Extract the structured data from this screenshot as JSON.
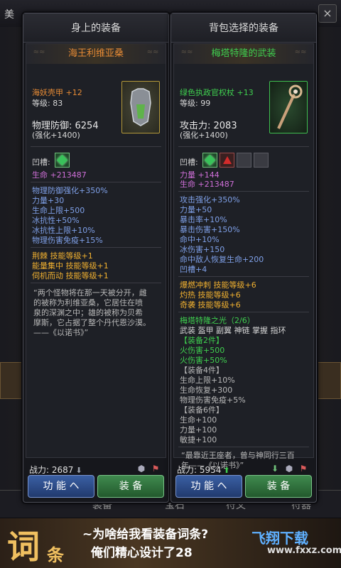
{
  "background": {
    "title_partial": "美",
    "close_glyph": "×",
    "tabs": [
      "装备",
      "宝石",
      "符文",
      "符器"
    ]
  },
  "left": {
    "panel_title": "身上的装备",
    "item_name": "海王利维亚桑",
    "item_type": "海妖壳甲 +12",
    "level": "等级: 83",
    "main_stat": "物理防御: 6254",
    "enhance": "(强化+1400)",
    "sockets_label": "凹槽:",
    "sockets": [
      "gem"
    ],
    "gem_bonus": "生命 +213487",
    "props": [
      "物理防御强化+350%",
      "力量+30",
      "生命上限+500",
      "冰抗性+50%",
      "冰抗性上限+10%",
      "物理伤害免疫+15%"
    ],
    "skills": [
      "荆棘 技能等级+1",
      "能量集中 技能等级+1",
      "伺机而动 技能等级+1"
    ],
    "lore": [
      "“两个怪物将在那一天被分开，雌",
      "的被称为利维亚桑，它居住在喷",
      "泉的深渊之中；雄的被称为贝希",
      "摩斯，它占据了整个丹代恩沙漠。",
      "——《以诺书》”"
    ],
    "power": "战力: 2687",
    "power_arrow": "⬇",
    "btn_func": "功 能 ヘ",
    "btn_equip": "装 备"
  },
  "right": {
    "panel_title": "背包选择的装备",
    "item_name": "梅塔特隆的武装",
    "item_type": "绿色执政官权杖 +13",
    "level": "等级: 99",
    "main_stat": "攻击力: 2083",
    "enhance": "(强化+1400)",
    "sockets_label": "凹槽:",
    "sockets": [
      "gem",
      "red",
      "empty",
      "empty"
    ],
    "gem_bonus": [
      "力量 +144",
      "生命 +213487"
    ],
    "props": [
      "攻击强化+350%",
      "力量+50",
      "暴击率+10%",
      "暴击伤害+150%",
      "命中+10%",
      "冰伤害+150",
      "命中敌人恢复生命+200",
      "凹槽+4"
    ],
    "skills": [
      "爆燃冲刺 技能等级+6",
      "灼热 技能等级+6",
      "奇袭 技能等级+6"
    ],
    "set_title": "梅塔特隆之光（2/6）",
    "set_pieces": "武装 盔甲 副翼 神链 掌握 指环",
    "set_bonus": [
      "【装备2件】",
      "火伤害+500",
      "火伤害+50%",
      "【装备4件】",
      "生命上限+10%",
      "生命恢复+300",
      "物理伤害免疫+5%",
      "【装备6件】",
      "生命+100",
      "力量+100",
      "敏捷+100"
    ],
    "lore": [
      "“最靠近王座者，曾与神同行三百",
      "年——《以诺书》”"
    ],
    "power": "战力: 5954",
    "power_arrow": "⬆",
    "btn_func": "功 能 ヘ",
    "btn_equip": "装 备"
  },
  "banner": {
    "big": "词",
    "small": "条",
    "line1": "~为啥给我看装备词条?",
    "line2": "俺们精心设计了28",
    "watermark_top": "飞翔下载",
    "watermark_bottom": "www.fxxz.com"
  },
  "colors": {
    "orange": "#e78b35",
    "green": "#3fcf4f",
    "gold": "#f0b030",
    "pink": "#cf6fd8",
    "blue": "#7fa0e8"
  }
}
